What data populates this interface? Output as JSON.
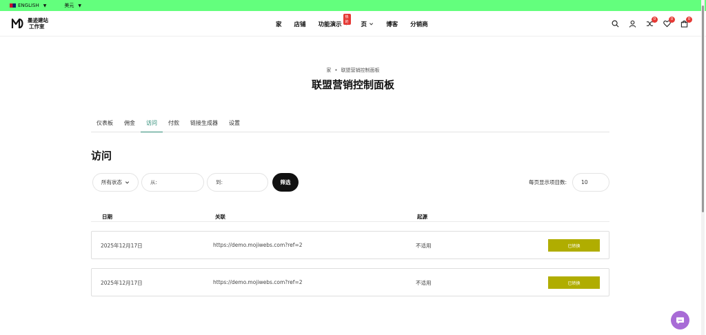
{
  "topbar": {
    "language": "ENGLISH",
    "currency": "美元",
    "caret": "▼"
  },
  "header": {
    "logo": {
      "line1": "墨迹建站",
      "line2": "工作室"
    },
    "nav": [
      {
        "label": "家"
      },
      {
        "label": "店铺"
      },
      {
        "label": "功能演示",
        "badge": "热的",
        "has_dropdown": true
      },
      {
        "label": "页",
        "has_dropdown": true
      },
      {
        "label": "博客"
      },
      {
        "label": "分销商"
      }
    ],
    "counts": {
      "compare": "0",
      "wishlist": "0",
      "cart": "0"
    }
  },
  "breadcrumb": {
    "home": "家",
    "separator": "•",
    "current": "联盟营销控制面板"
  },
  "page_title": "联盟营销控制面板",
  "tabs": [
    {
      "label": "仪表板",
      "active": false
    },
    {
      "label": "佣金",
      "active": false
    },
    {
      "label": "访问",
      "active": true
    },
    {
      "label": "付款",
      "active": false
    },
    {
      "label": "链接生成器",
      "active": false
    },
    {
      "label": "设置",
      "active": false
    }
  ],
  "section_title": "访问",
  "filters": {
    "status_value": "所有状态",
    "from_placeholder": "从:",
    "to_placeholder": "到:",
    "filter_button": "筛选",
    "per_page_label": "每页显示项目数:",
    "per_page_value": "10"
  },
  "table": {
    "headers": {
      "date": "日期",
      "link": "关联",
      "source": "起源"
    },
    "rows": [
      {
        "date": "2025年12月17日",
        "link": "https://demo.mojiwebs.com?ref=2",
        "source": "不适用",
        "status": "已转换"
      },
      {
        "date": "2025年12月17日",
        "link": "https://demo.mojiwebs.com?ref=2",
        "source": "不适用",
        "status": "已转换"
      }
    ]
  },
  "colors": {
    "topbar": "#63ff7d",
    "accent": "#2a8a74",
    "status": "#b0ad00",
    "badge": "#e53935",
    "chat": "#a86bd6"
  }
}
